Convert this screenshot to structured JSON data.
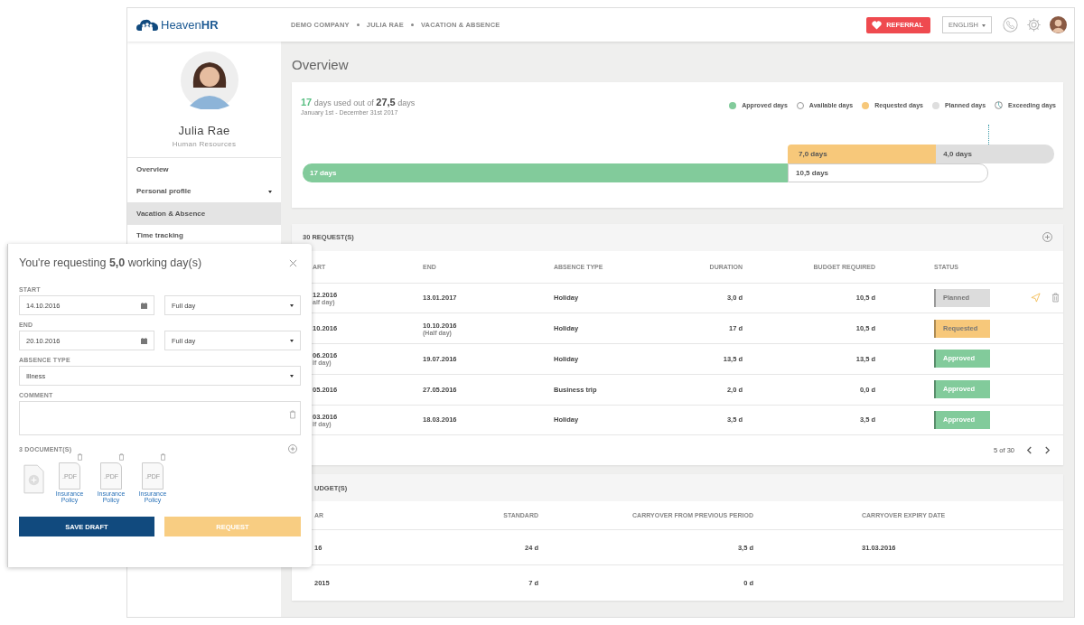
{
  "header": {
    "logo": "Heaven**HR**",
    "breadcrumbs": [
      "DEMO COMPANY",
      "JULIA RAE",
      "VACATION & ABSENCE"
    ],
    "referral": "REFERRAL",
    "language": "ENGLISH"
  },
  "profile": {
    "name": "Julia Rae",
    "role": "Human Resources"
  },
  "sidebar": {
    "items": [
      {
        "label": "Overview",
        "selected": false,
        "caret": false
      },
      {
        "label": "Personal profile",
        "selected": false,
        "caret": true
      },
      {
        "label": "Vacation & Absence",
        "selected": true,
        "caret": false
      },
      {
        "label": "Time tracking",
        "selected": false,
        "caret": false
      }
    ]
  },
  "page_title": "Overview",
  "summary": {
    "used": "17",
    "used_text": "days used out of",
    "total": "27,5",
    "total_text": "days",
    "period": "January 1st - December 31st  2017",
    "legend": [
      {
        "label": "Approved days",
        "kind": "filled",
        "color": "#82cb9b"
      },
      {
        "label": "Available days",
        "kind": "outline",
        "color": "#ffffff"
      },
      {
        "label": "Requested days",
        "kind": "filled",
        "color": "#f7c87a"
      },
      {
        "label": "Planned days",
        "kind": "filled",
        "color": "#dedede"
      },
      {
        "label": "Exceeding days",
        "kind": "exceeding"
      }
    ],
    "upper_bar": [
      {
        "label": "7,0 days",
        "color": "#f7c87a"
      },
      {
        "label": "4,0 days",
        "color": "#dedede"
      }
    ],
    "lower_bar": [
      {
        "label": "17 days",
        "color": "#82cb9b"
      },
      {
        "label": "10,5 days",
        "color": "#ffffff"
      }
    ]
  },
  "requests": {
    "title": "30 REQUEST(S)",
    "columns": [
      "ART",
      "END",
      "ABSENCE TYPE",
      "DURATION",
      "BUDGET REQUIRED",
      "STATUS"
    ],
    "rows": [
      {
        "start": "12.2016",
        "start_note": "alf day)",
        "end": "13.01.2017",
        "type": "Holiday",
        "duration": "3,0 d",
        "budget": "10,5 d",
        "status": "Planned",
        "color": "#dcdcdc",
        "actions": true
      },
      {
        "start": "10.2016",
        "end": "10.10.2016",
        "end_note": "(Half day)",
        "type": "Holiday",
        "duration": "17 d",
        "budget": "10,5 d",
        "status": "Requested",
        "color": "#f7c87a",
        "actions": false
      },
      {
        "start": "06.2016",
        "start_note": "lf day)",
        "end": "19.07.2016",
        "type": "Holiday",
        "duration": "13,5 d",
        "budget": "13,5 d",
        "status": "Approved",
        "color": "#82cb9b",
        "actions": false
      },
      {
        "start": "05.2016",
        "end": "27.05.2016",
        "type": "Business trip",
        "duration": "2,0 d",
        "budget": "0,0 d",
        "status": "Approved",
        "color": "#82cb9b",
        "actions": false
      },
      {
        "start": "03.2016",
        "start_note": "lf day)",
        "end": "18.03.2016",
        "type": "Holiday",
        "duration": "3,5 d",
        "budget": "3,5 d",
        "status": "Approved",
        "color": "#82cb9b",
        "actions": false
      }
    ],
    "pager": "5 of 30"
  },
  "budgets": {
    "title": "UDGET(S)",
    "columns": [
      "AR",
      "STANDARD",
      "CARRYOVER FROM PREVIOUS PERIOD",
      "CARRYOVER EXPIRY DATE"
    ],
    "rows": [
      {
        "year": "16",
        "standard": "24 d",
        "carryover": "3,5 d",
        "expiry": "31.03.2016"
      },
      {
        "year": "2015",
        "standard": "7 d",
        "carryover": "0 d"
      }
    ]
  },
  "dialog": {
    "title": "You're requesting **5,0** working day(s)",
    "start_label": "START",
    "start_date": "14.10.2016",
    "start_span": "Full day",
    "end_label": "END",
    "end_date": "20.10.2016",
    "end_span": "Full day",
    "type_label": "ABSENCE TYPE",
    "type": "Illness",
    "comment_label": "COMMENT",
    "documents_label": "3 DOCUMENT(S)",
    "documents": [
      {
        "ext": ".PDF",
        "name": "Insurance Policy"
      },
      {
        "ext": ".PDF",
        "name": "Insurance Policy"
      },
      {
        "ext": ".PDF",
        "name": "Insurance Policy"
      }
    ],
    "save": "SAVE DRAFT",
    "request": "REQUEST"
  }
}
